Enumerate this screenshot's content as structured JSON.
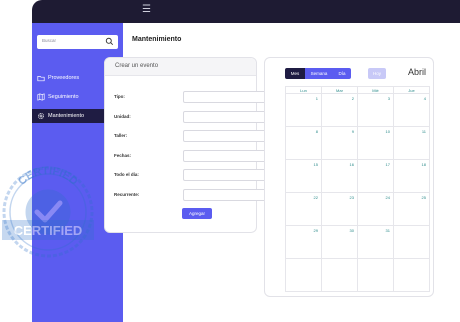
{
  "topbar": {
    "menu_icon": "hamburger-icon"
  },
  "sidebar": {
    "search": {
      "placeholder": "Buscar",
      "icon": "search-icon"
    },
    "items": [
      {
        "label": "Proveedores",
        "icon": "folder-icon",
        "chevron": "⌄",
        "active": false
      },
      {
        "label": "Seguimiento",
        "icon": "map-icon",
        "chevron": "⌄",
        "active": false
      },
      {
        "label": "Mantenimiento",
        "icon": "gear-icon",
        "chevron": "⌄",
        "active": true
      }
    ]
  },
  "page": {
    "title": "Mantenimiento"
  },
  "form": {
    "heading": "Crear un evento",
    "fields": [
      {
        "label": "Tipo:",
        "value": ""
      },
      {
        "label": "Unidad:",
        "value": ""
      },
      {
        "label": "Taller:",
        "value": ""
      },
      {
        "label": "Fechas:",
        "value": ""
      },
      {
        "label": "Todo el día:",
        "value": ""
      },
      {
        "label": "Recurrente:",
        "value": ""
      }
    ],
    "submit_label": "Agregar"
  },
  "calendar": {
    "views": {
      "month": "Mes",
      "week": "Semana",
      "day": "Día"
    },
    "today_label": "Hoy",
    "title": "Abril",
    "weekdays": [
      "Lun",
      "Mar",
      "Mié",
      "Jue"
    ],
    "weeks": [
      [
        "1",
        "2",
        "3",
        "4"
      ],
      [
        "8",
        "9",
        "10",
        "11"
      ],
      [
        "15",
        "16",
        "17",
        "18"
      ],
      [
        "22",
        "23",
        "24",
        "25"
      ],
      [
        "29",
        "30",
        "31",
        ""
      ],
      [
        "",
        "",
        "",
        ""
      ]
    ]
  },
  "badge": {
    "text": "CERTIFIED",
    "icon": "certified-stamp-icon"
  },
  "colors": {
    "accent": "#5b5cf0",
    "dark": "#1f1c43",
    "topbar": "#1e1b33"
  }
}
